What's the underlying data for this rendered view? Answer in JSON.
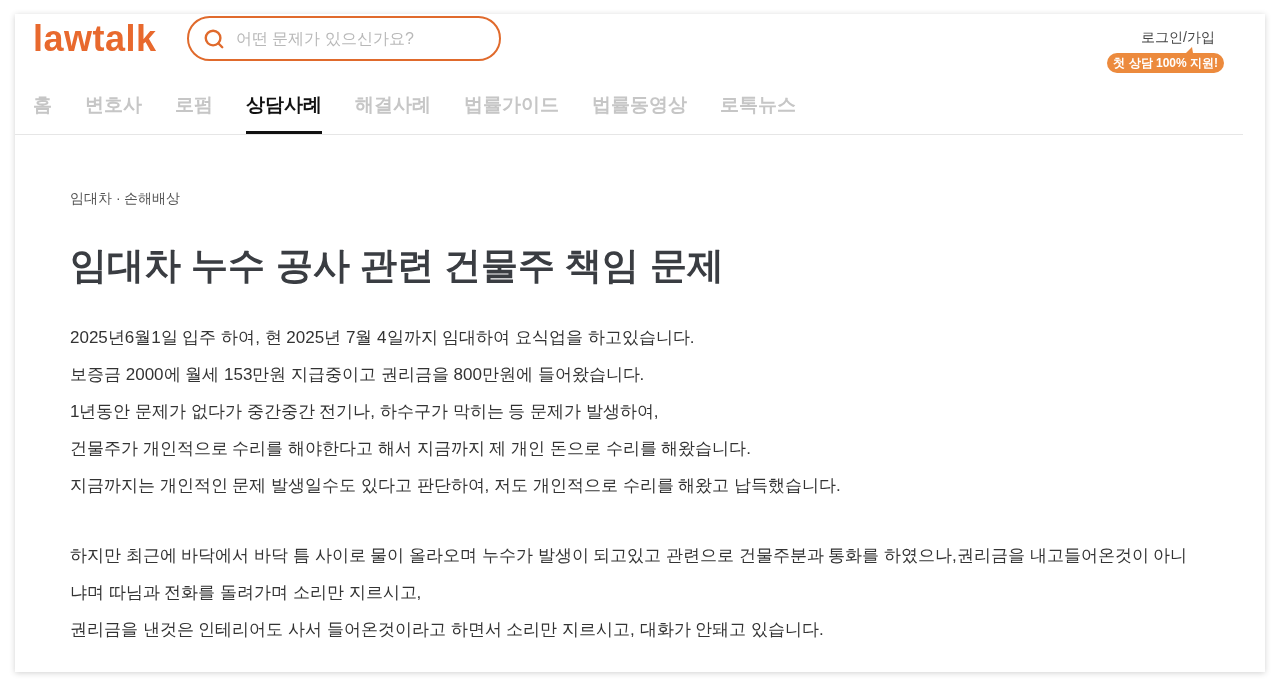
{
  "header": {
    "logo": "lawtalk",
    "search": {
      "placeholder": "어떤 문제가 있으신가요?"
    },
    "login": "로그인/가입",
    "promo_badge": "첫 상담 100% 지원!"
  },
  "nav": {
    "tabs": [
      {
        "label": "홈",
        "selected": false
      },
      {
        "label": "변호사",
        "selected": false
      },
      {
        "label": "로펌",
        "selected": false
      },
      {
        "label": "상담사례",
        "selected": true
      },
      {
        "label": "해결사례",
        "selected": false
      },
      {
        "label": "법률가이드",
        "selected": false
      },
      {
        "label": "법률동영상",
        "selected": false
      },
      {
        "label": "로톡뉴스",
        "selected": false
      }
    ]
  },
  "article": {
    "breadcrumb": "임대차 · 손해배상",
    "title": "임대차 누수 공사 관련 건물주 책임 문제",
    "paragraphs": [
      {
        "lines": [
          "2025년6월1일 입주 하여, 현 2025년 7월 4일까지 임대하여 요식업을 하고있습니다.",
          "보증금 2000에 월세 153만원 지급중이고 권리금을 800만원에 들어왔습니다.",
          "1년동안 문제가 없다가 중간중간 전기나, 하수구가 막히는 등 문제가 발생하여,",
          "건물주가 개인적으로 수리를 해야한다고 해서 지금까지 제 개인 돈으로 수리를 해왔습니다.",
          "지금까지는 개인적인 문제 발생일수도 있다고 판단하여, 저도 개인적으로 수리를 해왔고 납득했습니다."
        ]
      },
      {
        "lines": [
          "하지만 최근에 바닥에서 바닥 틈 사이로 물이 올라오며 누수가 발생이 되고있고 관련으로 건물주분과 통화를 하였으나,권리금을 내고들어온것이 아니냐며 따님과 전화를 돌려가며 소리만 지르시고,",
          "권리금을 낸것은 인테리어도 사서 들어온것이라고 하면서 소리만 지르시고, 대화가 안돼고 있습니다."
        ]
      }
    ]
  }
}
